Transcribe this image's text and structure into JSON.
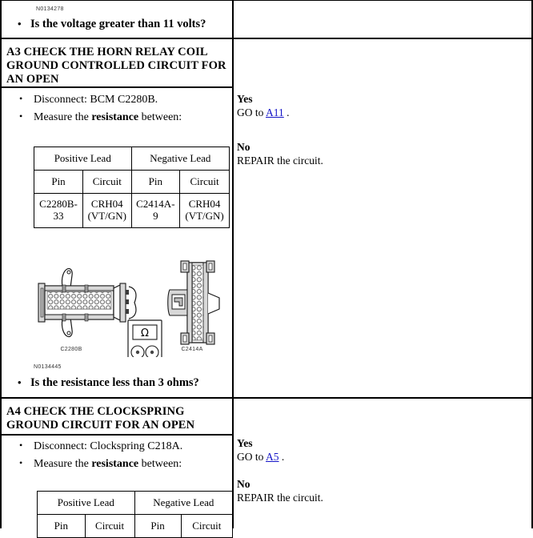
{
  "document": {
    "type": "pinpoint-test",
    "top_partial_step": {
      "figure_code": "N0134278",
      "question": "Is the voltage greater than 11 volts?",
      "bullet": "•"
    },
    "steps": [
      {
        "id": "A3",
        "title": "A3 CHECK THE HORN RELAY COIL GROUND CONTROLLED CIRCUIT FOR AN OPEN",
        "title_lines": [
          "A3 CHECK THE HORN RELAY COIL",
          "GROUND CONTROLLED CIRCUIT FOR",
          "AN OPEN"
        ],
        "actions": [
          {
            "bullet": "•",
            "text": "Disconnect: BCM C2280B."
          },
          {
            "bullet": "•",
            "pre": "Measure the ",
            "strong": "resistance",
            "post": " between:"
          }
        ],
        "lead_table": {
          "group_headers": [
            "Positive Lead",
            "Negative Lead"
          ],
          "column_headers": [
            "Pin",
            "Circuit",
            "Pin",
            "Circuit"
          ],
          "rows": [
            [
              "C2280B-33",
              "CRH04 (VT/GN)",
              "C2414A-9",
              "CRH04 (VT/GN)"
            ]
          ]
        },
        "figure": {
          "code": "N0134445",
          "left_connector_label": "C2280B",
          "right_connector_label": "C2414A",
          "meter_symbol": "Ω",
          "meter_probe_positive": "+",
          "meter_probe_negative": "−"
        },
        "question": "Is the resistance less than 3 ohms?",
        "question_bullet": "•",
        "result": {
          "yes_label": "Yes",
          "yes_action_pre": "GO to ",
          "yes_link": "A11",
          "yes_action_post": " .",
          "no_label": "No",
          "no_action": "REPAIR the circuit."
        }
      },
      {
        "id": "A4",
        "title": "A4 CHECK THE CLOCKSPRING GROUND CIRCUIT FOR AN OPEN",
        "title_lines": [
          "A4 CHECK THE CLOCKSPRING",
          "GROUND CIRCUIT FOR AN OPEN"
        ],
        "actions": [
          {
            "bullet": "•",
            "text": "Disconnect: Clockspring C218A."
          },
          {
            "bullet": "•",
            "pre": "Measure the ",
            "strong": "resistance",
            "post": " between:"
          }
        ],
        "lead_table": {
          "group_headers": [
            "Positive Lead",
            "Negative Lead"
          ],
          "column_headers": [
            "Pin",
            "Circuit",
            "Pin",
            "Circuit"
          ],
          "rows": []
        },
        "result": {
          "yes_label": "Yes",
          "yes_action_pre": "GO to ",
          "yes_link": "A5",
          "yes_action_post": " .",
          "no_label": "No",
          "no_action": "REPAIR the circuit."
        }
      }
    ],
    "colors": {
      "link": "#1414c8",
      "text": "#000000",
      "rule": "#000000",
      "background": "#ffffff",
      "figure_line": "#1a1a1a",
      "figure_fill": "#d8d8d8"
    }
  }
}
